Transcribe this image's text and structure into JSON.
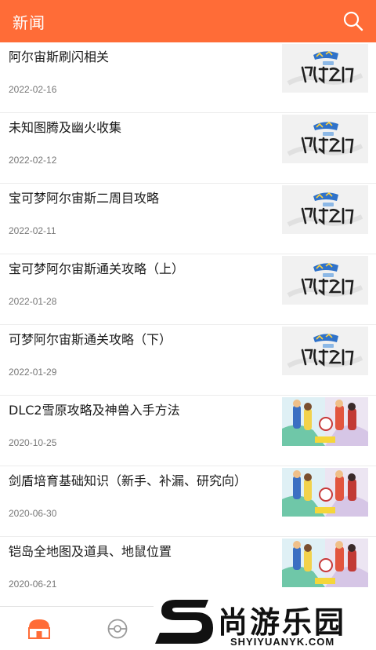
{
  "header": {
    "title": "新闻",
    "accent_color": "#ff6c37",
    "search_icon": "search-icon"
  },
  "articles": [
    {
      "title": "阿尔宙斯刷闪相关",
      "date": "2022-02-16",
      "thumb": "pokemon-legends-arceus-logo"
    },
    {
      "title": "未知图腾及幽火收集",
      "date": "2022-02-12",
      "thumb": "pokemon-legends-arceus-logo"
    },
    {
      "title": "宝可梦阿尔宙斯二周目攻略",
      "date": "2022-02-11",
      "thumb": "pokemon-legends-arceus-logo"
    },
    {
      "title": "宝可梦阿尔宙斯通关攻略（上）",
      "date": "2022-01-28",
      "thumb": "pokemon-legends-arceus-logo"
    },
    {
      "title": "可梦阿尔宙斯通关攻略（下）",
      "date": "2022-01-29",
      "thumb": "pokemon-legends-arceus-logo"
    },
    {
      "title": "DLC2雪原攻略及神兽入手方法",
      "date": "2020-10-25",
      "thumb": "pokemon-sword-shield-expansion-art"
    },
    {
      "title": "剑盾培育基础知识（新手、补漏、研究向）",
      "date": "2020-06-30",
      "thumb": "pokemon-sword-shield-expansion-art"
    },
    {
      "title": "铠岛全地图及道具、地鼠位置",
      "date": "2020-06-21",
      "thumb": "pokemon-sword-shield-expansion-art"
    }
  ],
  "tabbar": {
    "tabs": [
      {
        "icon": "pokemon-center-icon",
        "active": true
      },
      {
        "icon": "pokeball-icon",
        "active": false
      }
    ]
  },
  "watermark": {
    "main": "尚游乐园",
    "sub": "SHYIYUANYK.COM"
  }
}
